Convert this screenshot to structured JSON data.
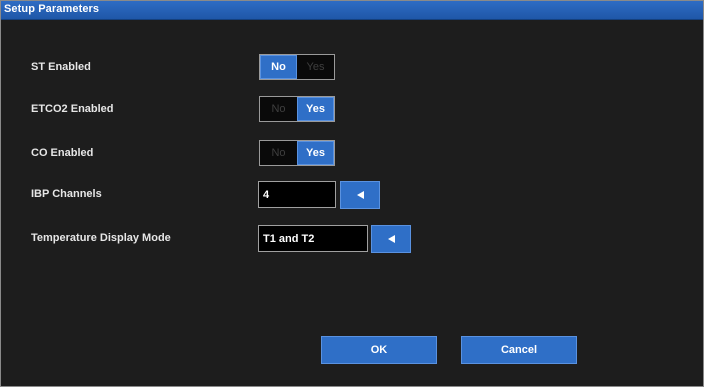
{
  "dialog": {
    "title": "Setup Parameters"
  },
  "rows": {
    "st": {
      "label": "ST Enabled",
      "options": [
        "No",
        "Yes"
      ],
      "selected": "No"
    },
    "etco2": {
      "label": "ETCO2 Enabled",
      "options": [
        "No",
        "Yes"
      ],
      "selected": "Yes"
    },
    "co": {
      "label": "CO Enabled",
      "options": [
        "No",
        "Yes"
      ],
      "selected": "Yes"
    },
    "ibp": {
      "label": "IBP Channels",
      "value": "4"
    },
    "temp": {
      "label": "Temperature Display Mode",
      "value": "T1 and T2"
    }
  },
  "buttons": {
    "ok": "OK",
    "cancel": "Cancel"
  },
  "colors": {
    "accent": "#2f6fc7",
    "background": "#1d1d1d",
    "title_bar": "#1f57a8"
  }
}
